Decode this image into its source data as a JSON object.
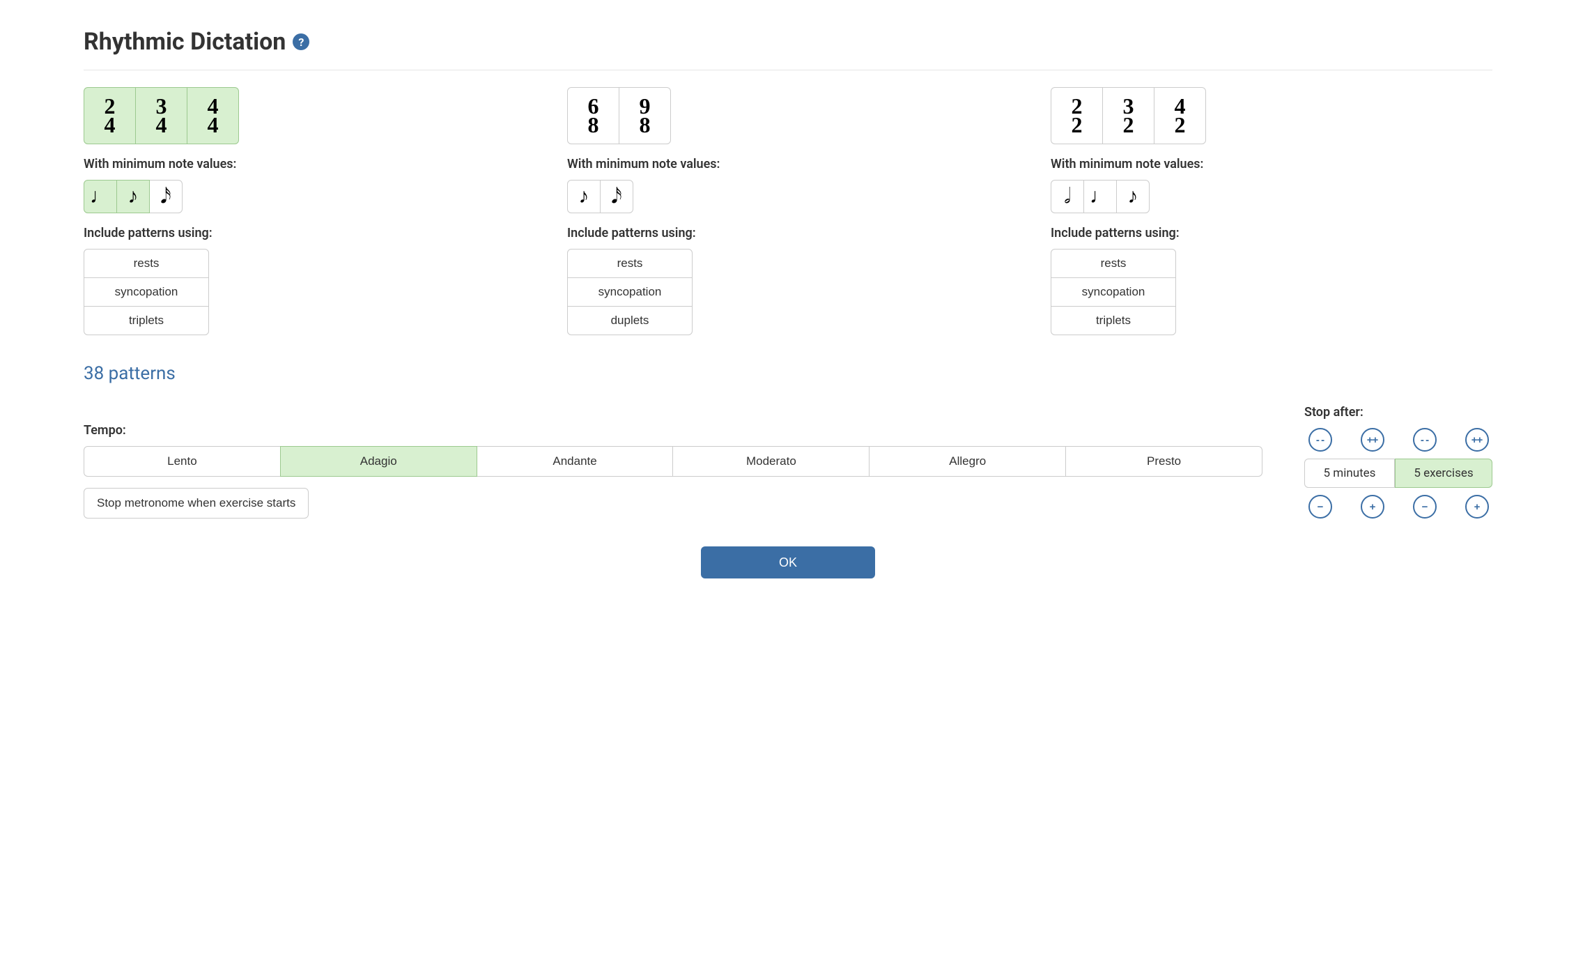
{
  "title": "Rhythmic Dictation",
  "labels": {
    "min_note": "With minimum note values:",
    "include": "Include patterns using:",
    "tempo": "Tempo:",
    "stop_after": "Stop after:"
  },
  "columns": [
    {
      "signatures": [
        {
          "top": "2",
          "bottom": "4",
          "selected": true
        },
        {
          "top": "3",
          "bottom": "4",
          "selected": true
        },
        {
          "top": "4",
          "bottom": "4",
          "selected": true
        }
      ],
      "notes": [
        {
          "glyph": "♩",
          "selected": true,
          "name": "quarter-note"
        },
        {
          "glyph": "♪",
          "selected": true,
          "name": "eighth-note"
        },
        {
          "glyph": "𝅘𝅥𝅯",
          "selected": false,
          "name": "sixteenth-note"
        }
      ],
      "patterns": [
        "rests",
        "syncopation",
        "triplets"
      ]
    },
    {
      "signatures": [
        {
          "top": "6",
          "bottom": "8",
          "selected": false
        },
        {
          "top": "9",
          "bottom": "8",
          "selected": false
        }
      ],
      "notes": [
        {
          "glyph": "♪",
          "selected": false,
          "name": "eighth-note"
        },
        {
          "glyph": "𝅘𝅥𝅯",
          "selected": false,
          "name": "sixteenth-note"
        }
      ],
      "patterns": [
        "rests",
        "syncopation",
        "duplets"
      ]
    },
    {
      "signatures": [
        {
          "top": "2",
          "bottom": "2",
          "selected": false
        },
        {
          "top": "3",
          "bottom": "2",
          "selected": false
        },
        {
          "top": "4",
          "bottom": "2",
          "selected": false
        }
      ],
      "notes": [
        {
          "glyph": "𝅗𝅥",
          "selected": false,
          "name": "half-note"
        },
        {
          "glyph": "♩",
          "selected": false,
          "name": "quarter-note"
        },
        {
          "glyph": "♪",
          "selected": false,
          "name": "eighth-note"
        }
      ],
      "patterns": [
        "rests",
        "syncopation",
        "triplets"
      ]
    }
  ],
  "patterns_count": "38 patterns",
  "tempo": {
    "options": [
      "Lento",
      "Adagio",
      "Andante",
      "Moderato",
      "Allegro",
      "Presto"
    ],
    "selected": 1
  },
  "metronome_toggle": "Stop metronome when exercise starts",
  "stop_after": {
    "minutes": "5 minutes",
    "exercises": "5 exercises",
    "selected": "exercises",
    "buttons": {
      "big_minus": "- -",
      "big_plus": "++",
      "minus": "−",
      "plus": "+"
    }
  },
  "ok": "OK"
}
